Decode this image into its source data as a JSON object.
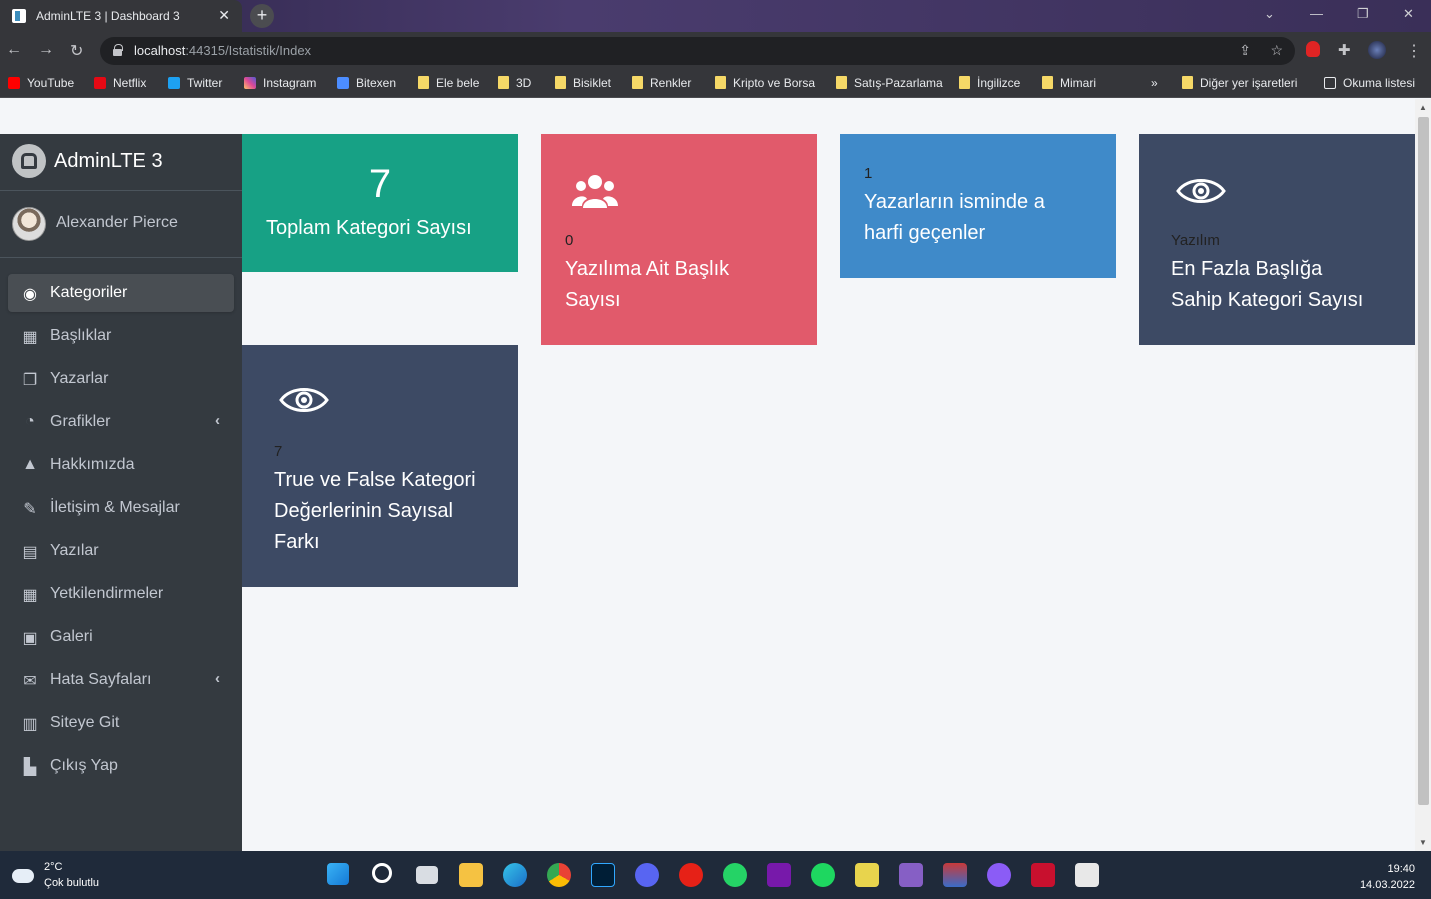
{
  "browser": {
    "tab_title": "AdminLTE 3 | Dashboard 3",
    "url_host": "localhost",
    "url_path": ":44315/Istatistik/Index",
    "bookmarks": [
      "YouTube",
      "Netflix",
      "Twitter",
      "Instagram",
      "Bitexen",
      "Ele bele",
      "3D",
      "Bisiklet",
      "Renkler",
      "Kripto ve Borsa",
      "Satış-Pazarlama",
      "İngilizce",
      "Mimari"
    ],
    "other_bookmarks": "Diğer yer işaretleri",
    "reading_list": "Okuma listesi",
    "overflow": "»"
  },
  "sidebar": {
    "brand": "AdminLTE 3",
    "user": "Alexander Pierce",
    "items": [
      {
        "label": "Kategoriler",
        "icon": "dashboard-icon",
        "glyph": "◉",
        "active": true
      },
      {
        "label": "Başlıklar",
        "icon": "grid-icon",
        "glyph": "▦"
      },
      {
        "label": "Yazarlar",
        "icon": "copy-icon",
        "glyph": "❐"
      },
      {
        "label": "Grafikler",
        "icon": "pie-chart-icon",
        "glyph": "◔",
        "arrow": "‹"
      },
      {
        "label": "Hakkımızda",
        "icon": "tree-icon",
        "glyph": "▲"
      },
      {
        "label": "İletişim & Mesajlar",
        "icon": "edit-icon",
        "glyph": "✎"
      },
      {
        "label": "Yazılar",
        "icon": "table-icon",
        "glyph": "▤"
      },
      {
        "label": "Yetkilendirmeler",
        "icon": "calendar-icon",
        "glyph": "▦"
      },
      {
        "label": "Galeri",
        "icon": "image-icon",
        "glyph": "▣"
      },
      {
        "label": "Hata Sayfaları",
        "icon": "envelope-icon",
        "glyph": "✉",
        "arrow": "‹"
      },
      {
        "label": "Siteye Git",
        "icon": "book-icon",
        "glyph": "▥"
      },
      {
        "label": "Çıkış Yap",
        "icon": "sign-out-icon",
        "glyph": "▙"
      }
    ]
  },
  "boxes": {
    "total_categories": {
      "value": "7",
      "label": "Toplam Kategori Sayısı"
    },
    "software_titles": {
      "value": "0",
      "label_line1": "Yazılıma Ait Başlık",
      "label_line2": "Sayısı"
    },
    "authors_a": {
      "value": "1",
      "label_line1": "Yazarların isminde a",
      "label_line2": "harfi geçenler"
    },
    "top_category": {
      "value": "Yazılım",
      "label_line1": "En Fazla Başlığa",
      "label_line2": "Sahip Kategori Sayısı"
    },
    "true_false_diff": {
      "value": "7",
      "label_line1": "True ve False Kategori",
      "label_line2": "Değerlerinin Sayısal",
      "label_line3": "Farkı"
    }
  },
  "taskbar": {
    "temperature": "2°C",
    "weather": "Çok bulutlu",
    "time": "19:40",
    "date": "14.03.2022"
  },
  "colors": {
    "green": "#17a185",
    "red": "#e15a6b",
    "blue": "#3f8ac9",
    "navy": "#3d4a64",
    "sidebar": "#343a40"
  }
}
